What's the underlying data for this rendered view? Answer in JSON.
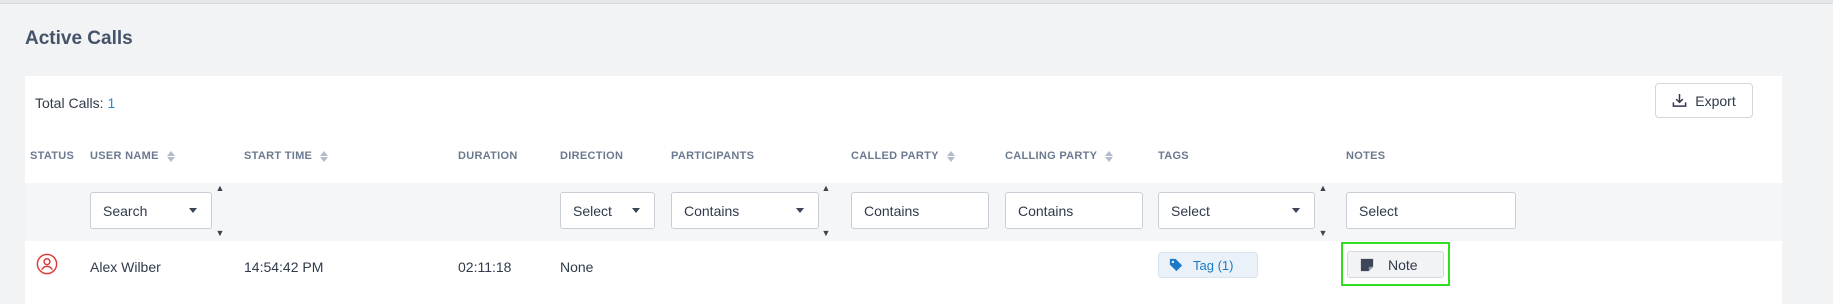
{
  "page": {
    "title": "Active Calls"
  },
  "summary": {
    "total_label": "Total Calls:",
    "total_count": "1"
  },
  "toolbar": {
    "export_label": "Export"
  },
  "columns": {
    "status": "STATUS",
    "user_name": "USER NAME",
    "start_time": "START TIME",
    "duration": "DURATION",
    "direction": "DIRECTION",
    "participants": "PARTICIPANTS",
    "called_party": "CALLED PARTY",
    "calling_party": "CALLING PARTY",
    "tags": "TAGS",
    "notes": "NOTES"
  },
  "filters": {
    "user_name": "Search",
    "direction": "Select",
    "participants": "Contains",
    "called_party": "Contains",
    "calling_party": "Contains",
    "tags": "Select",
    "notes": "Select"
  },
  "rows": [
    {
      "status_icon": "user-circle-icon",
      "user_name": "Alex Wilber",
      "start_time": "14:54:42 PM",
      "duration": "02:11:18",
      "direction": "None",
      "tag_label": "Tag (1)",
      "note_label": "Note"
    }
  ],
  "colors": {
    "accent": "#1a8bd6",
    "status_red": "#e03a3a",
    "highlight": "#33dd22"
  }
}
